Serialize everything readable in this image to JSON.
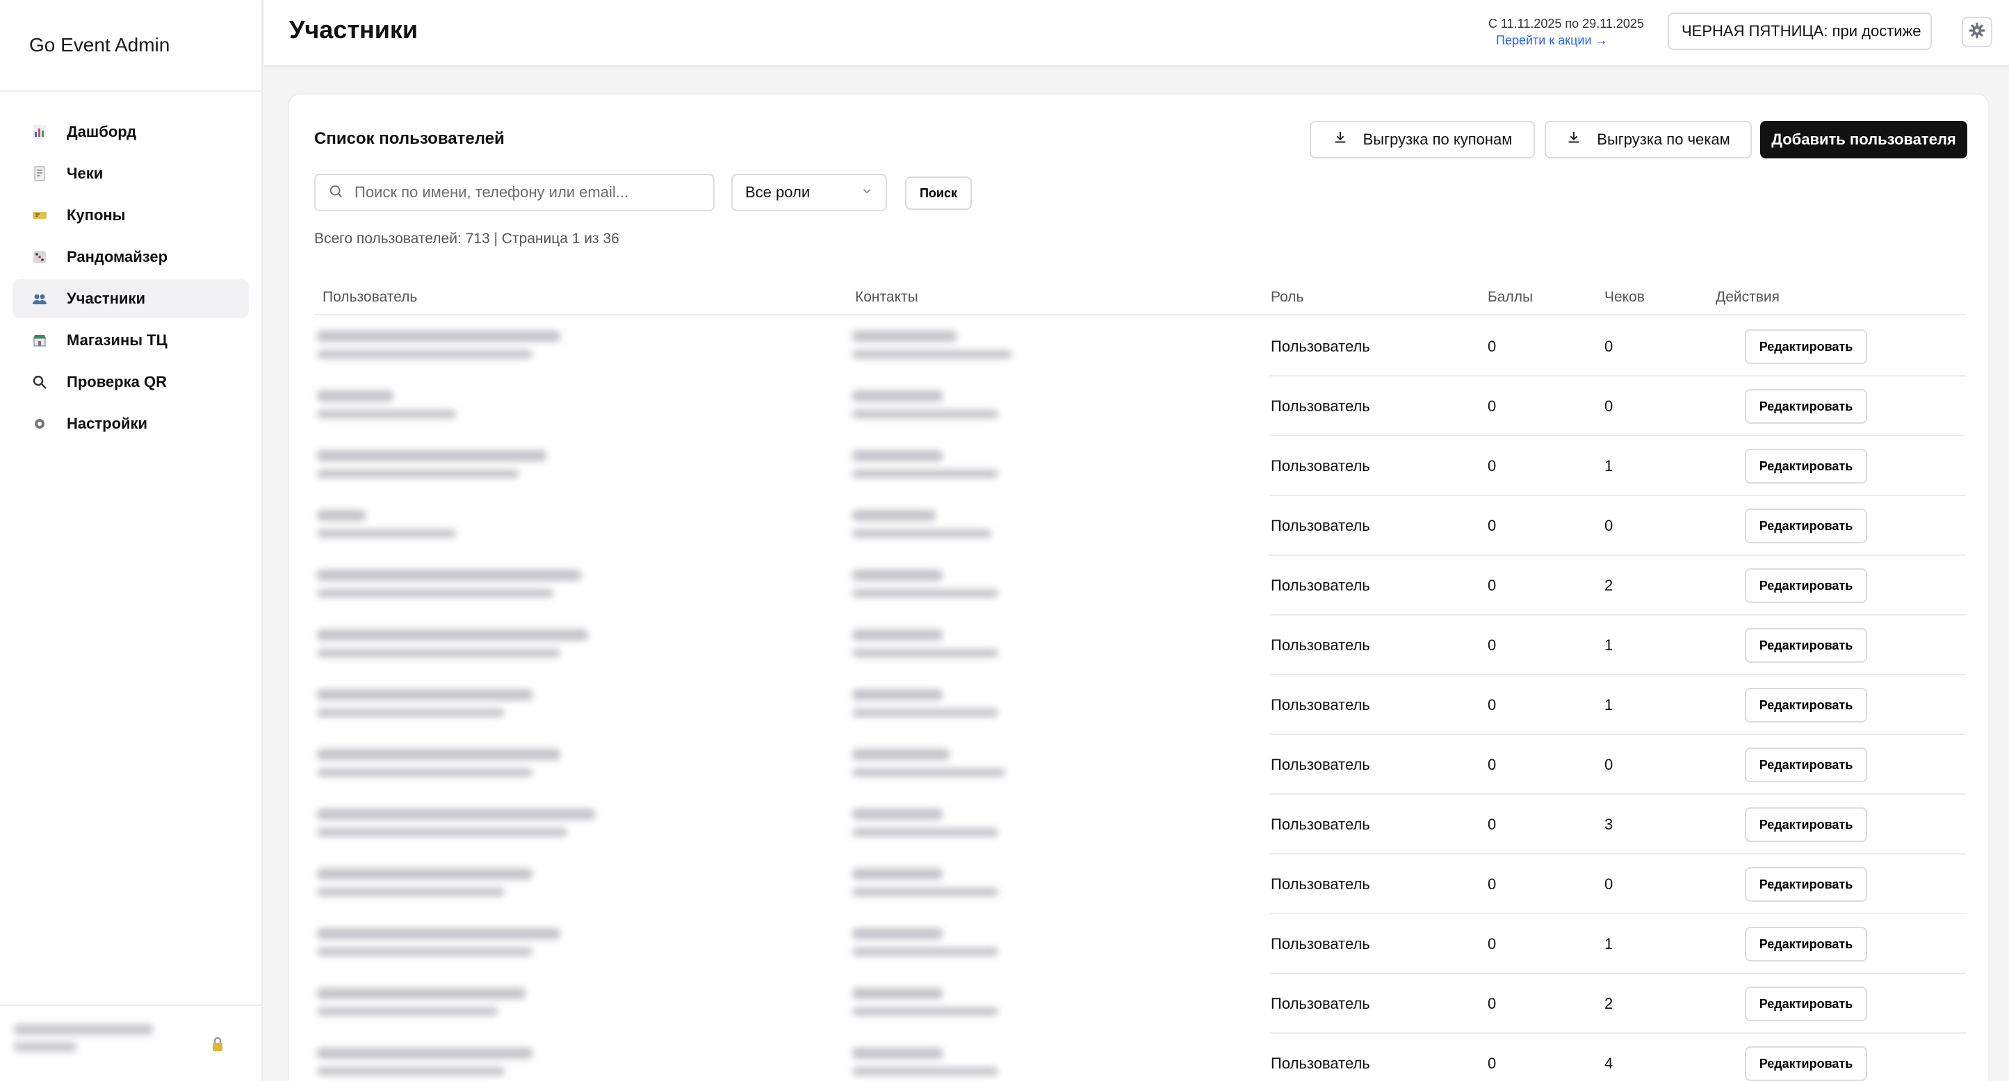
{
  "app": {
    "title": "Go Event Admin"
  },
  "sidebar": {
    "items": [
      {
        "label": "Дашборд",
        "icon": "bar-chart-icon",
        "active": false
      },
      {
        "label": "Чеки",
        "icon": "receipt-icon",
        "active": false
      },
      {
        "label": "Купоны",
        "icon": "ticket-icon",
        "active": false
      },
      {
        "label": "Рандомайзер",
        "icon": "dice-icon",
        "active": false
      },
      {
        "label": "Участники",
        "icon": "users-icon",
        "active": true
      },
      {
        "label": "Магазины ТЦ",
        "icon": "shop-icon",
        "active": false
      },
      {
        "label": "Проверка QR",
        "icon": "magnifier-icon",
        "active": false
      },
      {
        "label": "Настройки",
        "icon": "gear-icon",
        "active": false
      }
    ]
  },
  "header": {
    "title": "Участники",
    "promo_dates": "С 11.11.2025 по 29.11.2025",
    "promo_link": "Перейти к акции →",
    "promo_selected": "ЧЕРНАЯ ПЯТНИЦА: при достиже"
  },
  "card": {
    "title": "Список пользователей",
    "export_coupons": "Выгрузка по купонам",
    "export_receipts": "Выгрузка по чекам",
    "add_user": "Добавить пользователя",
    "search_placeholder": "Поиск по имени, телефону или email...",
    "role_filter": "Все роли",
    "search_button": "Поиск",
    "summary": "Всего пользователей: 713 | Страница 1 из 36"
  },
  "table": {
    "headers": {
      "user": "Пользователь",
      "contacts": "Контакты",
      "role": "Роль",
      "points": "Баллы",
      "receipts": "Чеков",
      "actions": "Действия"
    },
    "edit_label": "Редактировать",
    "rows": [
      {
        "role": "Пользователь",
        "points": "0",
        "receipts": "0"
      },
      {
        "role": "Пользователь",
        "points": "0",
        "receipts": "0"
      },
      {
        "role": "Пользователь",
        "points": "0",
        "receipts": "1"
      },
      {
        "role": "Пользователь",
        "points": "0",
        "receipts": "0"
      },
      {
        "role": "Пользователь",
        "points": "0",
        "receipts": "2"
      },
      {
        "role": "Пользователь",
        "points": "0",
        "receipts": "1"
      },
      {
        "role": "Пользователь",
        "points": "0",
        "receipts": "1"
      },
      {
        "role": "Пользователь",
        "points": "0",
        "receipts": "0"
      },
      {
        "role": "Пользователь",
        "points": "0",
        "receipts": "3"
      },
      {
        "role": "Пользователь",
        "points": "0",
        "receipts": "0"
      },
      {
        "role": "Пользователь",
        "points": "0",
        "receipts": "1"
      },
      {
        "role": "Пользователь",
        "points": "0",
        "receipts": "2"
      },
      {
        "role": "Пользователь",
        "points": "0",
        "receipts": "4"
      }
    ]
  },
  "colors": {
    "accent": "#111111",
    "link": "#2563eb",
    "border": "#dcdce0",
    "active_bg": "#f2f2f4"
  }
}
